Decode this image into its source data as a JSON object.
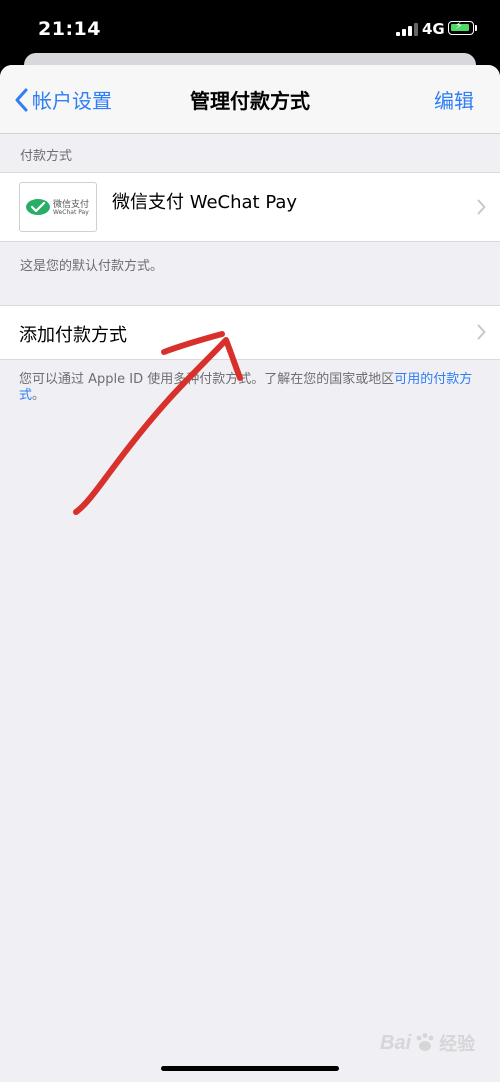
{
  "status_bar": {
    "time": "21:14",
    "network": "4G"
  },
  "nav": {
    "back_label": "帐户设置",
    "title": "管理付款方式",
    "edit_label": "编辑"
  },
  "payment_section": {
    "header": "付款方式",
    "method": {
      "logo_line1": "微信支付",
      "logo_line2": "WeChat Pay",
      "label": "微信支付 WeChat Pay"
    },
    "default_note": "这是您的默认付款方式。"
  },
  "add_row": {
    "label": "添加付款方式"
  },
  "footer": {
    "text": "您可以通过 Apple ID 使用多种付款方式。了解在您的国家或地区",
    "link": "可用的付款方式",
    "end": "。"
  },
  "watermark": {
    "logo_bai": "Bai",
    "logo_du": "经验"
  },
  "colors": {
    "accent": "#2f7ef5",
    "background": "#efeff4",
    "wechat_green": "#2aae67",
    "annotation_red": "#d8302b"
  }
}
